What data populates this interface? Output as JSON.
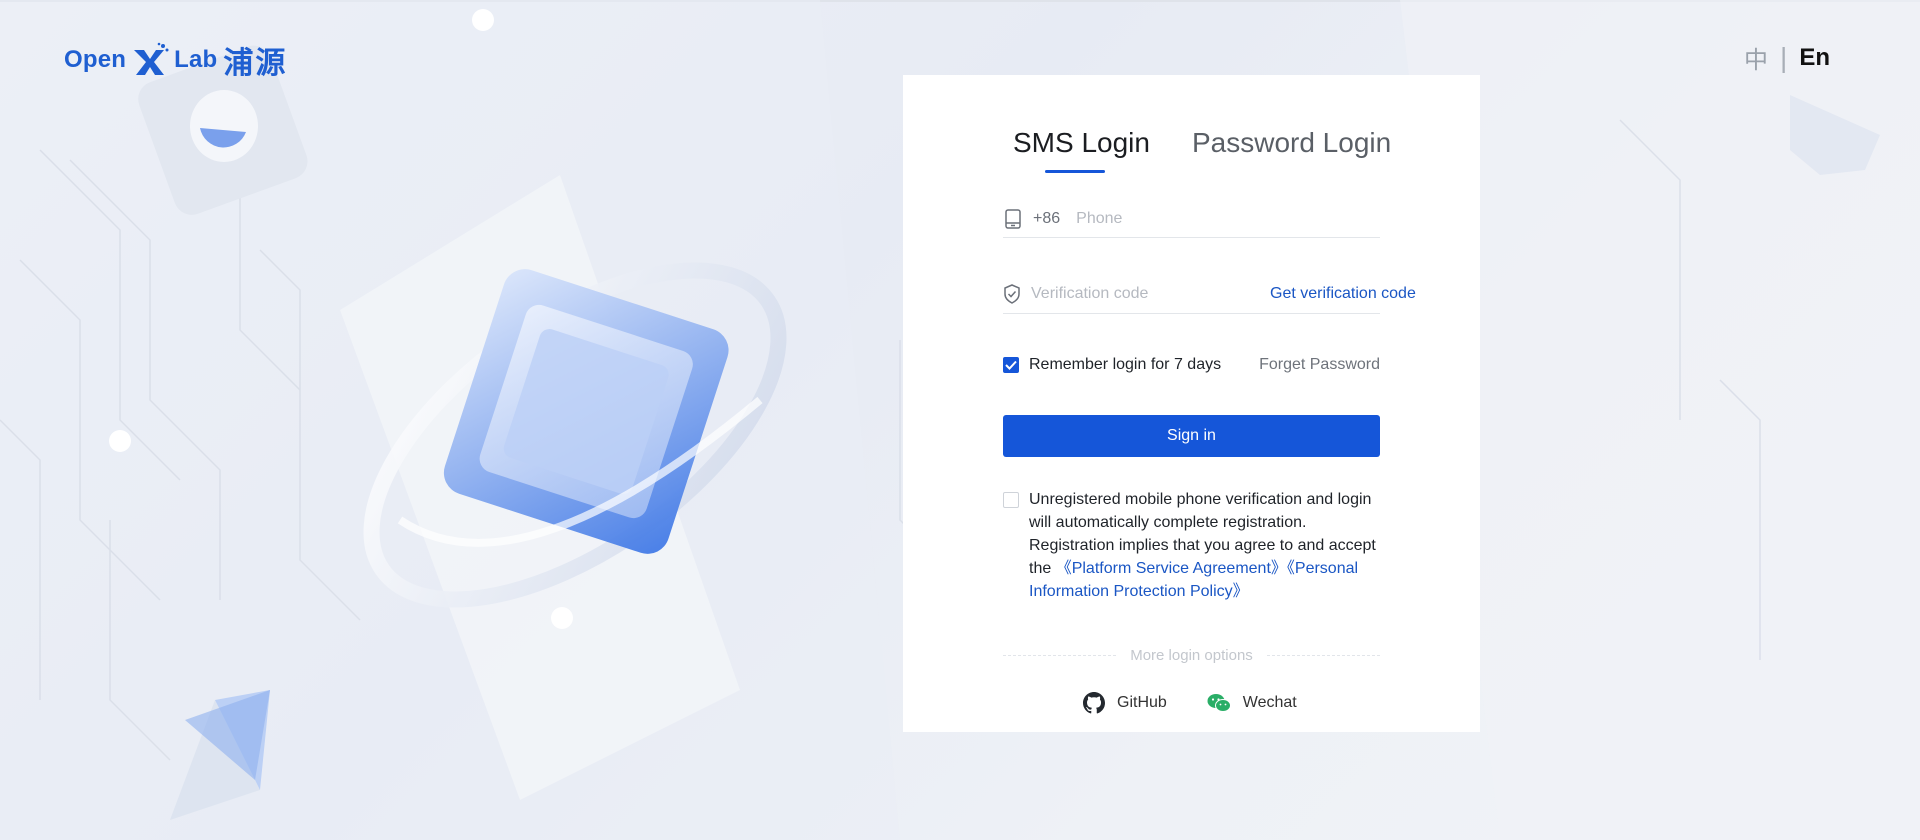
{
  "brand": {
    "logo_open": "Open",
    "logo_lab": "Lab",
    "logo_cn": "浦源",
    "color": "#1f5fd1"
  },
  "language": {
    "zh": "中",
    "separator": "|",
    "en": "En"
  },
  "login": {
    "tabs": [
      {
        "label": "SMS Login",
        "active": true
      },
      {
        "label": "Password Login",
        "active": false
      }
    ],
    "phone": {
      "icon": "phone-icon",
      "prefix": "+86",
      "placeholder": "Phone",
      "value": ""
    },
    "code": {
      "icon": "shield-check-icon",
      "placeholder": "Verification code",
      "value": "",
      "get_code_label": "Get verification code"
    },
    "remember": {
      "label": "Remember login for 7 days",
      "checked": true
    },
    "forget_label": "Forget Password",
    "submit_label": "Sign in",
    "agreement": {
      "checked": false,
      "text_1": "Unregistered mobile phone verification and login will automatically complete registration. Registration implies that you agree to and accept the",
      "link_1": "《Platform Service Agreement》",
      "link_2": "《Personal Information Protection Policy》"
    },
    "more_options_label": "More login options",
    "social": [
      {
        "label": "GitHub",
        "icon": "github-icon"
      },
      {
        "label": "Wechat",
        "icon": "wechat-icon"
      }
    ]
  },
  "colors": {
    "primary": "#1556d9",
    "link": "#1a56c4",
    "wechat": "#2aae67"
  }
}
